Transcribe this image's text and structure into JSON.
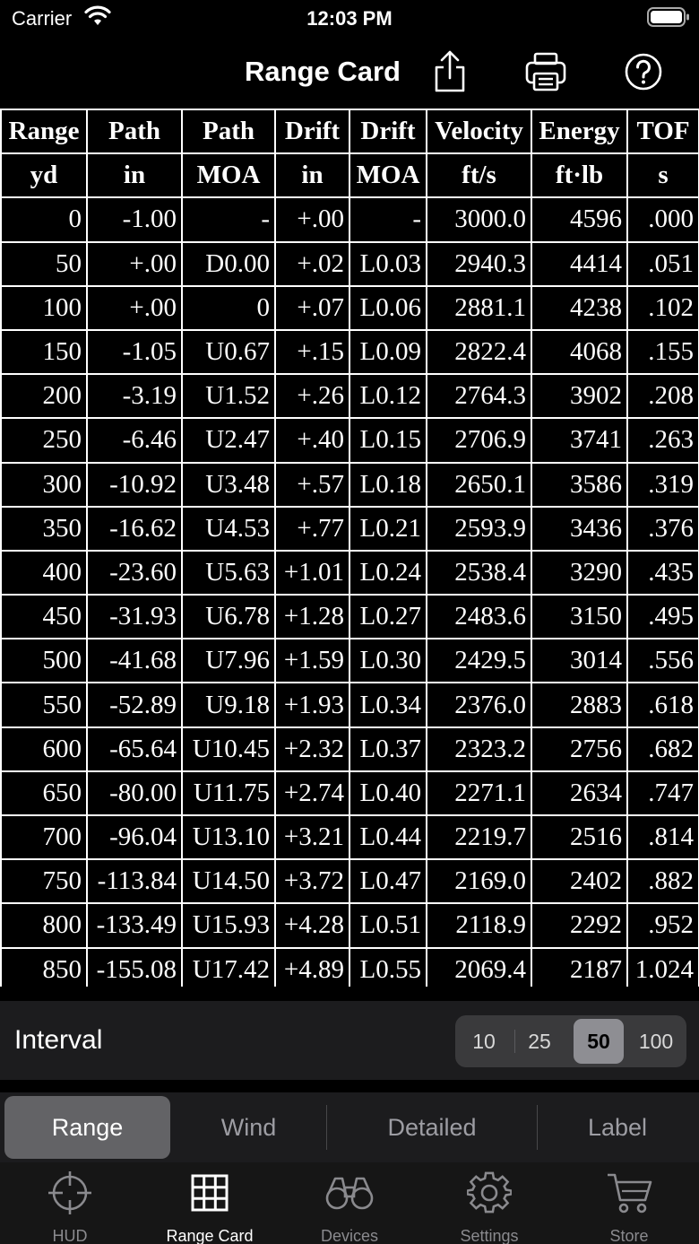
{
  "status": {
    "carrier": "Carrier",
    "time": "12:03 PM"
  },
  "nav": {
    "title": "Range Card"
  },
  "table": {
    "headers1": [
      "Range",
      "Path",
      "Path",
      "Drift",
      "Drift",
      "Velocity",
      "Energy",
      "TOF"
    ],
    "headers2": [
      "yd",
      "in",
      "MOA",
      "in",
      "MOA",
      "ft/s",
      "ft·lb",
      "s"
    ],
    "rows": [
      [
        "0",
        "-1.00",
        "-",
        "+.00",
        "-",
        "3000.0",
        "4596",
        ".000"
      ],
      [
        "50",
        "+.00",
        "D0.00",
        "+.02",
        "L0.03",
        "2940.3",
        "4414",
        ".051"
      ],
      [
        "100",
        "+.00",
        "0",
        "+.07",
        "L0.06",
        "2881.1",
        "4238",
        ".102"
      ],
      [
        "150",
        "-1.05",
        "U0.67",
        "+.15",
        "L0.09",
        "2822.4",
        "4068",
        ".155"
      ],
      [
        "200",
        "-3.19",
        "U1.52",
        "+.26",
        "L0.12",
        "2764.3",
        "3902",
        ".208"
      ],
      [
        "250",
        "-6.46",
        "U2.47",
        "+.40",
        "L0.15",
        "2706.9",
        "3741",
        ".263"
      ],
      [
        "300",
        "-10.92",
        "U3.48",
        "+.57",
        "L0.18",
        "2650.1",
        "3586",
        ".319"
      ],
      [
        "350",
        "-16.62",
        "U4.53",
        "+.77",
        "L0.21",
        "2593.9",
        "3436",
        ".376"
      ],
      [
        "400",
        "-23.60",
        "U5.63",
        "+1.01",
        "L0.24",
        "2538.4",
        "3290",
        ".435"
      ],
      [
        "450",
        "-31.93",
        "U6.78",
        "+1.28",
        "L0.27",
        "2483.6",
        "3150",
        ".495"
      ],
      [
        "500",
        "-41.68",
        "U7.96",
        "+1.59",
        "L0.30",
        "2429.5",
        "3014",
        ".556"
      ],
      [
        "550",
        "-52.89",
        "U9.18",
        "+1.93",
        "L0.34",
        "2376.0",
        "2883",
        ".618"
      ],
      [
        "600",
        "-65.64",
        "U10.45",
        "+2.32",
        "L0.37",
        "2323.2",
        "2756",
        ".682"
      ],
      [
        "650",
        "-80.00",
        "U11.75",
        "+2.74",
        "L0.40",
        "2271.1",
        "2634",
        ".747"
      ],
      [
        "700",
        "-96.04",
        "U13.10",
        "+3.21",
        "L0.44",
        "2219.7",
        "2516",
        ".814"
      ],
      [
        "750",
        "-113.84",
        "U14.50",
        "+3.72",
        "L0.47",
        "2169.0",
        "2402",
        ".882"
      ],
      [
        "800",
        "-133.49",
        "U15.93",
        "+4.28",
        "L0.51",
        "2118.9",
        "2292",
        ".952"
      ],
      [
        "850",
        "-155.08",
        "U17.42",
        "+4.89",
        "L0.55",
        "2069.4",
        "2187",
        "1.024"
      ]
    ]
  },
  "interval": {
    "label": "Interval",
    "options": [
      "10",
      "25",
      "50",
      "100"
    ],
    "selected": "50"
  },
  "modes": {
    "items": [
      "Range",
      "Wind",
      "Detailed",
      "Label"
    ],
    "selected": "Range"
  },
  "tabbar": {
    "items": [
      {
        "label": "HUD",
        "icon": "crosshair-icon"
      },
      {
        "label": "Range Card",
        "icon": "grid-icon"
      },
      {
        "label": "Devices",
        "icon": "binoculars-icon"
      },
      {
        "label": "Settings",
        "icon": "gear-icon"
      },
      {
        "label": "Store",
        "icon": "cart-icon"
      }
    ],
    "selected": "Range Card"
  }
}
